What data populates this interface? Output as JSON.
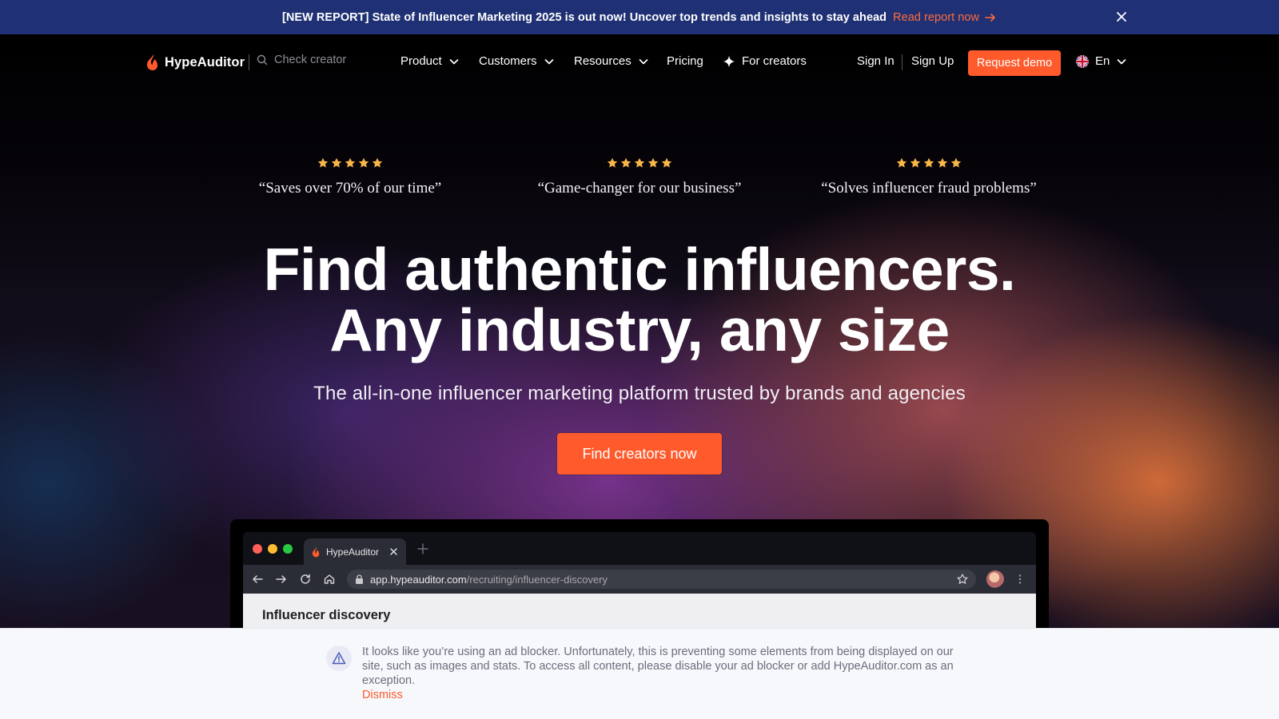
{
  "announcement": {
    "message": "[NEW REPORT] State of Influencer Marketing 2025 is out now! Uncover top trends and insights to stay ahead",
    "link_label": "Read report now",
    "close_icon": "close-icon"
  },
  "nav": {
    "brand": "HypeAuditor",
    "search_placeholder": "Check creator",
    "menu": [
      {
        "label": "Product",
        "has_dropdown": true
      },
      {
        "label": "Customers",
        "has_dropdown": true
      },
      {
        "label": "Resources",
        "has_dropdown": true
      },
      {
        "label": "Pricing",
        "has_dropdown": false
      },
      {
        "label": "For creators",
        "icon": "sparkle-icon"
      }
    ],
    "sign_in": "Sign In",
    "sign_up": "Sign Up",
    "request_demo": "Request demo",
    "language": "En"
  },
  "testimonials": [
    {
      "rating": 5,
      "quote": "“Saves over 70% of our time”"
    },
    {
      "rating": 5,
      "quote": "“Game-changer for our business”"
    },
    {
      "rating": 5,
      "quote": "“Solves influencer fraud problems”"
    }
  ],
  "hero": {
    "headline_line1": "Find authentic influencers.",
    "headline_line2": "Any industry, any size",
    "subheadline": "The all-in-one influencer marketing platform trusted by brands and agencies",
    "cta": "Find creators now"
  },
  "browser_mock": {
    "tab_title": "HypeAuditor",
    "url_host": "app.hypeauditor.com",
    "url_path": "/recruiting/influencer-discovery",
    "page_title": "Influencer discovery"
  },
  "ad_notice": {
    "text": "It looks like you’re using an ad blocker. Unfortunately, this is preventing some elements from being displayed on our site, such as images and stats. To access all content, please disable your ad blocker or add HypeAuditor.com as an exception.",
    "dismiss": "Dismiss"
  },
  "colors": {
    "accent": "#ff5a2c",
    "announce_bg": "#1f3174",
    "star": "#f7b54a"
  }
}
